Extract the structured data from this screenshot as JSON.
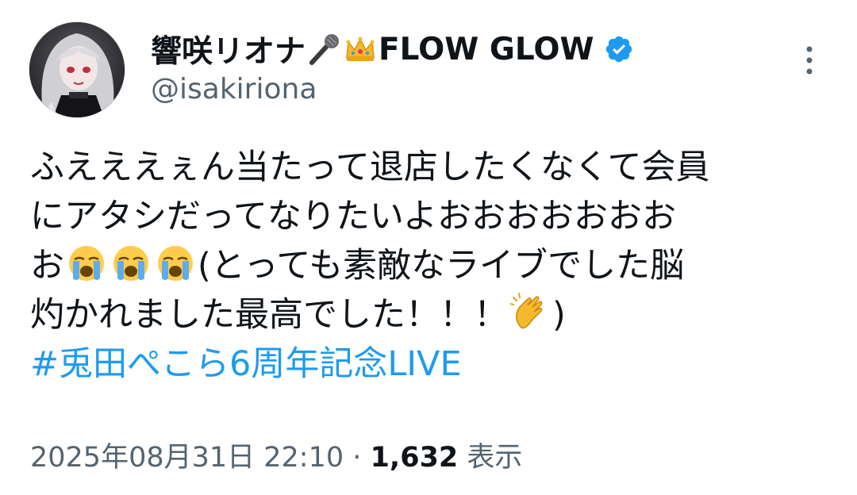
{
  "author": {
    "display_name": "響咲リオナ",
    "name_suffix": "FLOW GLOW",
    "name_emojis": [
      "microphone-icon",
      "crown-icon"
    ],
    "handle": "@isakiriona",
    "verified": true
  },
  "tweet": {
    "lines": [
      {
        "text": "ふえええぇん当たって退店したくなくて会員"
      },
      {
        "text": "にアタシだってなりたいよおおおおおおお"
      },
      {
        "pre": "お",
        "post": "(とっても素敵なライブでした脳"
      },
      {
        "pre": "灼かれました最高でした！！！",
        "post": ")"
      }
    ],
    "hashtag": "#兎田ぺこら6周年記念LIVE"
  },
  "meta": {
    "timestamp": "2025年08月31日 22:10",
    "separator": "·",
    "views_count": "1,632",
    "views_label": "表示"
  },
  "colors": {
    "link": "#1d9bf0",
    "secondary_text": "#536471",
    "primary_text": "#0f1419",
    "verified_badge": "#1d9bf0"
  },
  "icons": {
    "more": "more-vertical-icon",
    "verified": "verified-badge-icon",
    "crying": "loudly-crying-face-icon",
    "clap": "clapping-hands-icon"
  }
}
